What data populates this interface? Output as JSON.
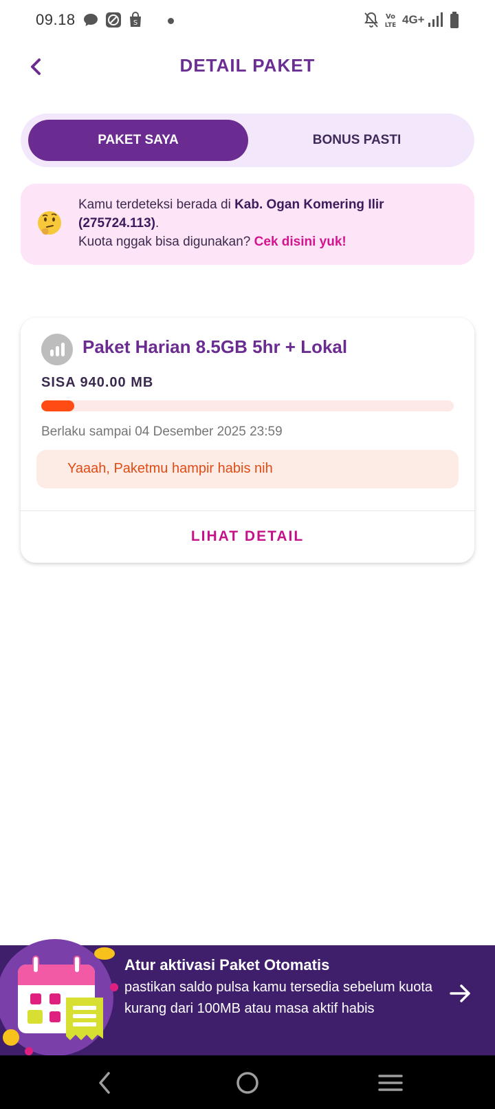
{
  "status_bar": {
    "time": "09.18",
    "network": "4G+",
    "volte": "VoLTE",
    "icons": [
      "chat-bubble-icon",
      "compass-app-icon",
      "shopping-bag-icon",
      "notification-dot",
      "mute-icon",
      "volte-icon",
      "network-4g-icon",
      "signal-icon",
      "battery-icon"
    ]
  },
  "header": {
    "title": "DETAIL PAKET",
    "back_icon": "chevron-left-icon"
  },
  "tabs": [
    {
      "label": "PAKET SAYA",
      "active": true
    },
    {
      "label": "BONUS PASTI",
      "active": false
    }
  ],
  "notice": {
    "emoji": "thinking-face",
    "line1_prefix": "Kamu terdeteksi berada di ",
    "location": "Kab. Ogan Komering Ilir (275724.113)",
    "line1_suffix": ".",
    "line2_prefix": "Kuota nggak bisa digunakan? ",
    "link": "Cek disini yuk!"
  },
  "package": {
    "icon": "signal-bars-icon",
    "name": "Paket Harian 8.5GB 5hr + Lokal",
    "remaining": "SISA 940.00 MB",
    "progress_fraction": 0.08,
    "validity": "Berlaku sampai 04 Desember 2025 23:59",
    "warning": "Yaaah, Paketmu hampir habis nih",
    "detail_label": "LIHAT DETAIL"
  },
  "promo": {
    "title": "Atur aktivasi Paket Otomatis",
    "body": "pastikan saldo pulsa kamu tersedia sebelum kuota kurang dari 100MB atau masa aktif habis",
    "arrow_icon": "arrow-right-icon"
  },
  "navbar": {
    "icons": [
      "nav-back-icon",
      "nav-home-icon",
      "nav-recents-icon"
    ]
  },
  "colors": {
    "primary": "#6b2c91",
    "accent_pink": "#d4148f",
    "progress": "#ff4b14",
    "promo_bg": "#3f1f6b"
  }
}
